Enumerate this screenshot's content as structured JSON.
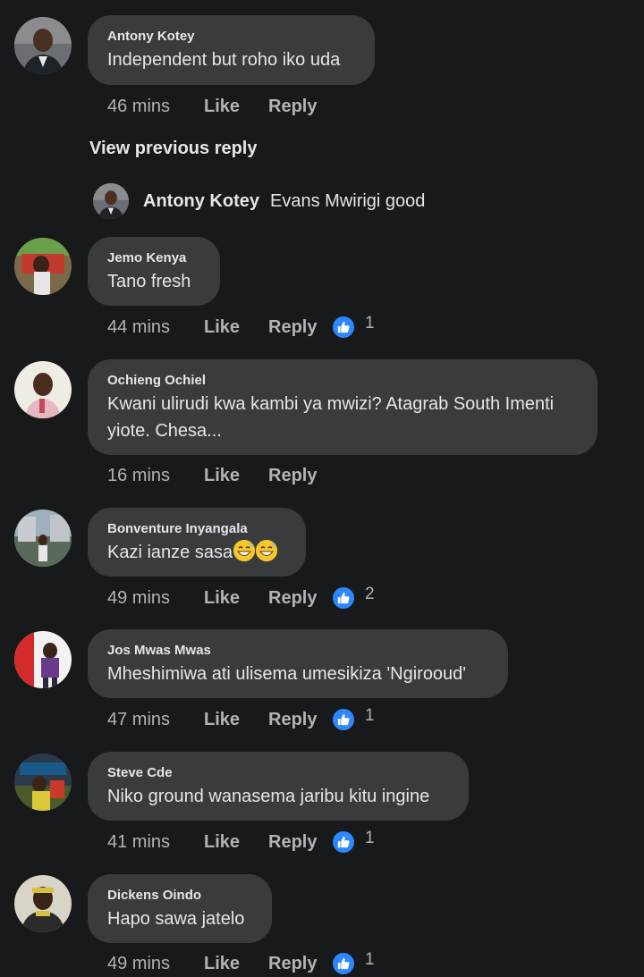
{
  "view_previous": "View previous reply",
  "reply_preview": {
    "author": "Antony Kotey",
    "text": "Evans Mwirigi good"
  },
  "actions": {
    "like": "Like",
    "reply": "Reply"
  },
  "comments": [
    {
      "author": "Antony Kotey",
      "text": "Independent but roho iko uda",
      "time": "46 mins",
      "reactions": ""
    },
    {
      "author": "Jemo Kenya",
      "text": "Tano fresh",
      "time": "44 mins",
      "reactions": "1"
    },
    {
      "author": "Ochieng Ochiel",
      "text": "Kwani ulirudi kwa kambi ya mwizi? Atagrab South Imenti",
      "text_line2": "yiote. Chesa...",
      "time": "16 mins",
      "reactions": ""
    },
    {
      "author": "Bonventure Inyangala",
      "text": "Kazi ianze sasa",
      "time": "49 mins",
      "reactions": "2"
    },
    {
      "author": "Jos Mwas Mwas",
      "text": "Mheshimiwa ati ulisema umesikiza 'Ngirooud'",
      "time": "47 mins",
      "reactions": "1"
    },
    {
      "author": "Steve Cde",
      "text": "Niko ground wanasema jaribu kitu ingine",
      "time": "41 mins",
      "reactions": "1"
    },
    {
      "author": "Dickens Oindo",
      "text": "Hapo sawa jatelo",
      "time": "49 mins",
      "reactions": "1"
    }
  ],
  "colors": {
    "background": "#18191a",
    "bubble": "#3a3b3c",
    "primary_text": "#e4e6eb",
    "secondary_text": "#b0b3b8",
    "like_badge": "#2d88ff"
  }
}
